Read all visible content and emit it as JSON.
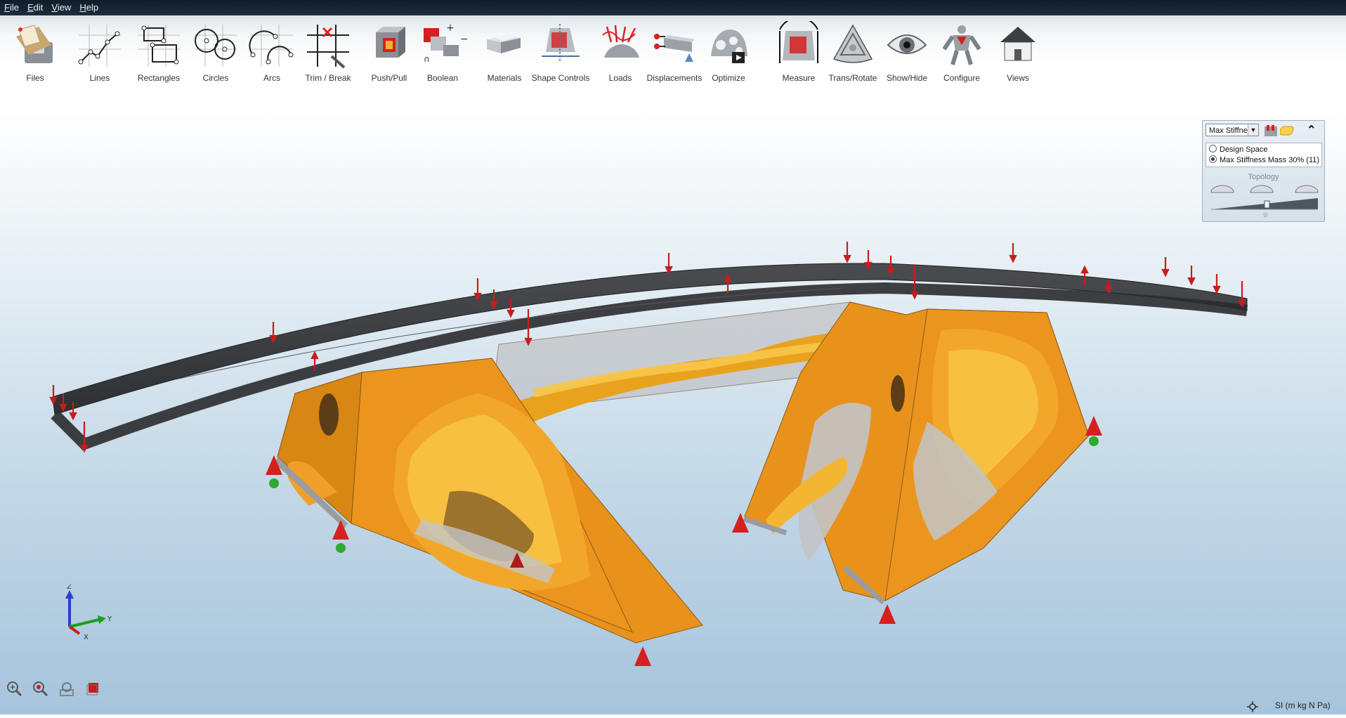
{
  "menu": [
    "File",
    "Edit",
    "View",
    "Help"
  ],
  "toolbar": {
    "tools": [
      {
        "label": "Files",
        "icon": "files-icon"
      },
      {
        "label": "Lines",
        "icon": "lines-icon"
      },
      {
        "label": "Rectangles",
        "icon": "rectangles-icon"
      },
      {
        "label": "Circles",
        "icon": "circles-icon"
      },
      {
        "label": "Arcs",
        "icon": "arcs-icon"
      },
      {
        "label": "Trim / Break",
        "icon": "trim-break-icon"
      },
      {
        "label": "Push/Pull",
        "icon": "push-pull-icon"
      },
      {
        "label": "Boolean",
        "icon": "boolean-icon"
      },
      {
        "label": "Materials",
        "icon": "materials-icon"
      },
      {
        "label": "Shape Controls",
        "icon": "shape-controls-icon"
      },
      {
        "label": "Loads",
        "icon": "loads-icon"
      },
      {
        "label": "Displacements",
        "icon": "displacements-icon"
      },
      {
        "label": "Optimize",
        "icon": "optimize-icon"
      },
      {
        "label": "Measure",
        "icon": "measure-icon"
      },
      {
        "label": "Trans/Rotate",
        "icon": "trans-rotate-icon"
      },
      {
        "label": "Show/Hide",
        "icon": "show-hide-icon"
      },
      {
        "label": "Configure",
        "icon": "configure-icon"
      },
      {
        "label": "Views",
        "icon": "views-icon"
      }
    ]
  },
  "results_panel": {
    "study_select": "Max Stiffne",
    "options": [
      {
        "label": "Design Space",
        "selected": false
      },
      {
        "label": "Max Stiffness Mass 30% (11)",
        "selected": true
      }
    ],
    "topology_label": "Topology"
  },
  "axis_triad": {
    "z": "Z",
    "y": "Y",
    "x": "X"
  },
  "status": {
    "units": "SI (m kg N Pa)"
  },
  "colors": {
    "part_orange": "#e8921c",
    "optimized_yellow": "#f4b430",
    "beam_dark": "#3a3c40",
    "load_red": "#cc1f1f",
    "support_green": "#2eaa2e"
  }
}
